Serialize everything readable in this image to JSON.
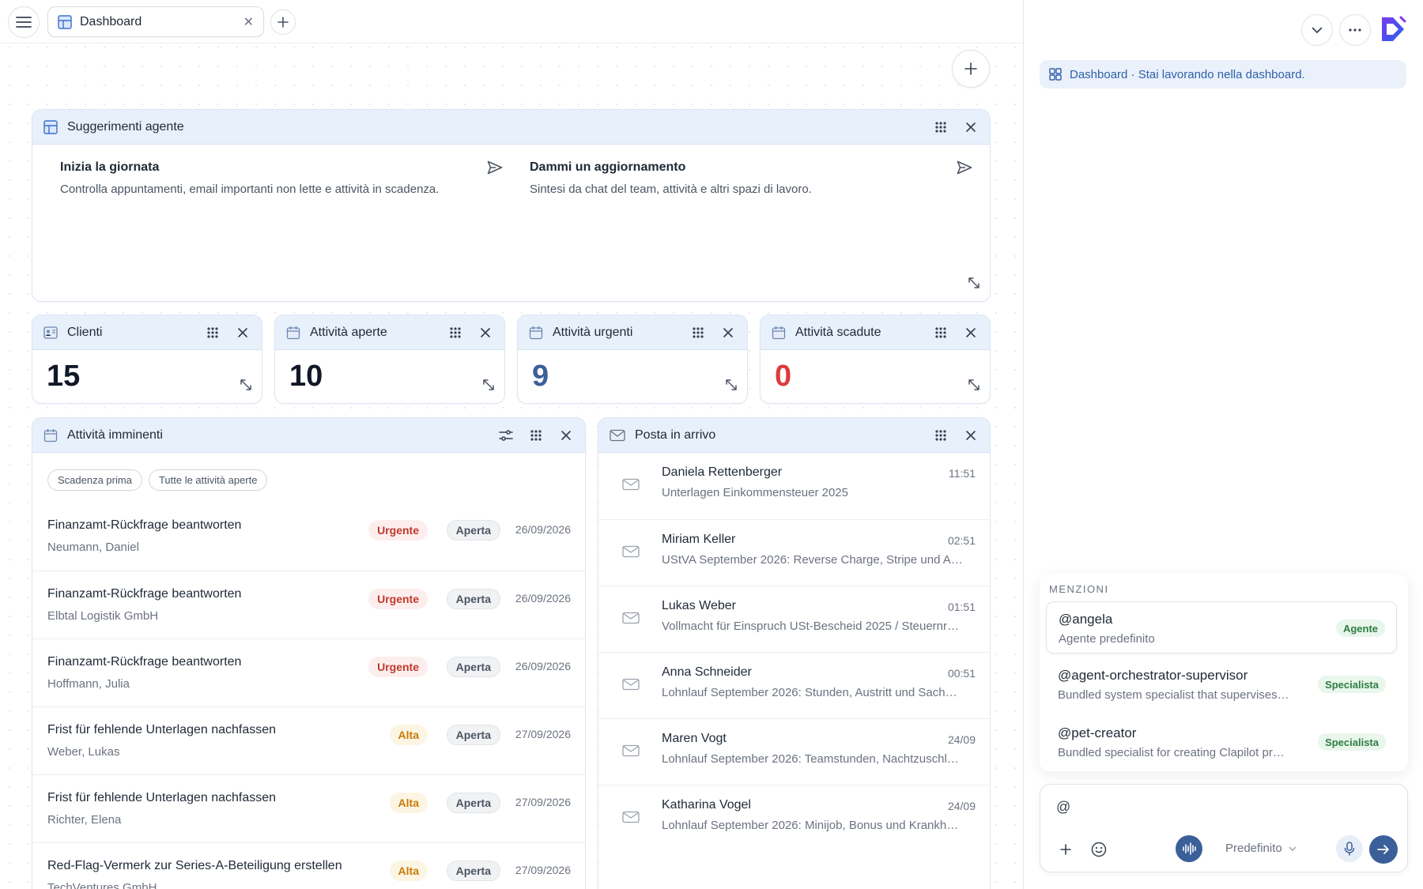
{
  "tab": {
    "label": "Dashboard"
  },
  "suggestions": {
    "title": "Suggerimenti agente",
    "items": [
      {
        "title": "Inizia la giornata",
        "desc": "Controlla appuntamenti, email importanti non lette e attività in scadenza."
      },
      {
        "title": "Dammi un aggiornamento",
        "desc": "Sintesi da chat del team, attività e altri spazi di lavoro."
      }
    ]
  },
  "metrics": [
    {
      "title": "Clienti",
      "value": "15",
      "color": "#111827"
    },
    {
      "title": "Attività aperte",
      "value": "10",
      "color": "#111827"
    },
    {
      "title": "Attività urgenti",
      "value": "9",
      "color": "#3b5f99"
    },
    {
      "title": "Attività scadute",
      "value": "0",
      "color": "#dc3b3b"
    }
  ],
  "tasks": {
    "title": "Attività imminenti",
    "filters": [
      "Scadenza prima",
      "Tutte le attività aperte"
    ],
    "rows": [
      {
        "title": "Finanzamt-Rückfrage beantworten",
        "client": "Neumann, Daniel",
        "priority": "Urgente",
        "status": "Aperta",
        "date": "26/09/2026"
      },
      {
        "title": "Finanzamt-Rückfrage beantworten",
        "client": "Elbtal Logistik GmbH",
        "priority": "Urgente",
        "status": "Aperta",
        "date": "26/09/2026"
      },
      {
        "title": "Finanzamt-Rückfrage beantworten",
        "client": "Hoffmann, Julia",
        "priority": "Urgente",
        "status": "Aperta",
        "date": "26/09/2026"
      },
      {
        "title": "Frist für fehlende Unterlagen nachfassen",
        "client": "Weber, Lukas",
        "priority": "Alta",
        "status": "Aperta",
        "date": "27/09/2026"
      },
      {
        "title": "Frist für fehlende Unterlagen nachfassen",
        "client": "Richter, Elena",
        "priority": "Alta",
        "status": "Aperta",
        "date": "27/09/2026"
      },
      {
        "title": "Red-Flag-Vermerk zur Series-A-Beteiligung erstellen",
        "client": "TechVentures GmbH",
        "priority": "Alta",
        "status": "Aperta",
        "date": "27/09/2026"
      }
    ]
  },
  "inbox": {
    "title": "Posta in arrivo",
    "rows": [
      {
        "sender": "Daniela Rettenberger",
        "subject": "Unterlagen Einkommensteuer 2025",
        "time": "11:51"
      },
      {
        "sender": "Miriam Keller",
        "subject": "UStVA September 2026: Reverse Charge, Stripe und A…",
        "time": "02:51"
      },
      {
        "sender": "Lukas Weber",
        "subject": "Vollmacht für Einspruch USt-Bescheid 2025 / Steuernr…",
        "time": "01:51"
      },
      {
        "sender": "Anna Schneider",
        "subject": "Lohnlauf September 2026: Stunden, Austritt und Sach…",
        "time": "00:51"
      },
      {
        "sender": "Maren Vogt",
        "subject": "Lohnlauf September 2026: Teamstunden, Nachtzuschl…",
        "time": "24/09"
      },
      {
        "sender": "Katharina Vogel",
        "subject": "Lohnlauf September 2026: Minijob, Bonus und Krankh…",
        "time": "24/09"
      }
    ]
  },
  "panel": {
    "context_label": "Dashboard",
    "context_text": " · Stai lavorando nella dashboard.",
    "mentions_header": "MENZIONI",
    "mentions": [
      {
        "handle": "@angela",
        "desc": "Agente predefinito",
        "tag": "Agente"
      },
      {
        "handle": "@agent-orchestrator-supervisor",
        "desc": "Bundled system specialist that supervises…",
        "tag": "Specialista"
      },
      {
        "handle": "@pet-creator",
        "desc": "Bundled specialist for creating Clapilot pr…",
        "tag": "Specialista"
      }
    ],
    "composer_value": "@",
    "model_label": "Predefinito"
  }
}
